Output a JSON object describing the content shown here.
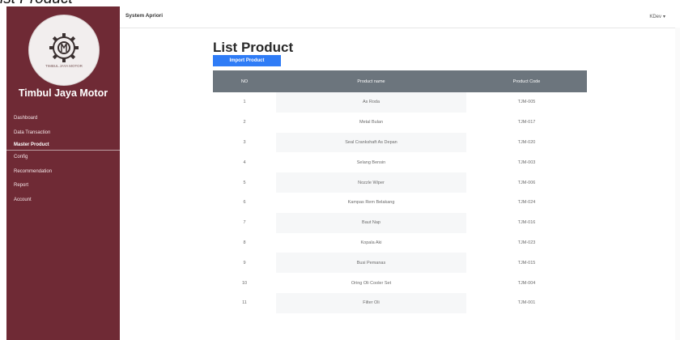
{
  "window": {
    "clipped_heading": "ist Product"
  },
  "sidebar": {
    "brand": "Timbul Jaya Motor",
    "logo_text": "TIMBUL JAYA MOTOR",
    "logo_icon": "gear-logo-icon",
    "items": [
      {
        "label": "Dashboard",
        "active": false
      },
      {
        "label": "Data Transaction",
        "active": false
      },
      {
        "label": "Master Product",
        "active": true
      },
      {
        "label": "Config",
        "active": false
      },
      {
        "label": "Recommendation",
        "active": false
      },
      {
        "label": "Report",
        "active": false
      },
      {
        "label": "Account",
        "active": false
      }
    ]
  },
  "topbar": {
    "app_title": "System Apriori",
    "user": "KDev",
    "user_caret": "▾"
  },
  "main": {
    "title": "List Product",
    "import_label": "Import Product",
    "table": {
      "headers": [
        "NO",
        "Product name",
        "Product Code"
      ],
      "rows": [
        [
          "1",
          "As Roda",
          "TJM-005"
        ],
        [
          "2",
          "Metal Bulan",
          "TJM-017"
        ],
        [
          "3",
          "Seal Crankshaft As Depan",
          "TJM-020"
        ],
        [
          "4",
          "Selang Bensin",
          "TJM-003"
        ],
        [
          "5",
          "Nozzle Wiper",
          "TJM-006"
        ],
        [
          "6",
          "Kampas Rem Belakang",
          "TJM-024"
        ],
        [
          "7",
          "Baut Nap",
          "TJM-016"
        ],
        [
          "8",
          "Kopala Aki",
          "TJM-023"
        ],
        [
          "9",
          "Busi Pemanas",
          "TJM-015"
        ],
        [
          "10",
          "Oring Oli Cooler Set",
          "TJM-004"
        ],
        [
          "11",
          "Filter Oli",
          "TJM-001"
        ]
      ]
    }
  },
  "colors": {
    "sidebar": "#6f2a35",
    "table_header": "#6c757d",
    "primary_button": "#2f7cf6"
  }
}
